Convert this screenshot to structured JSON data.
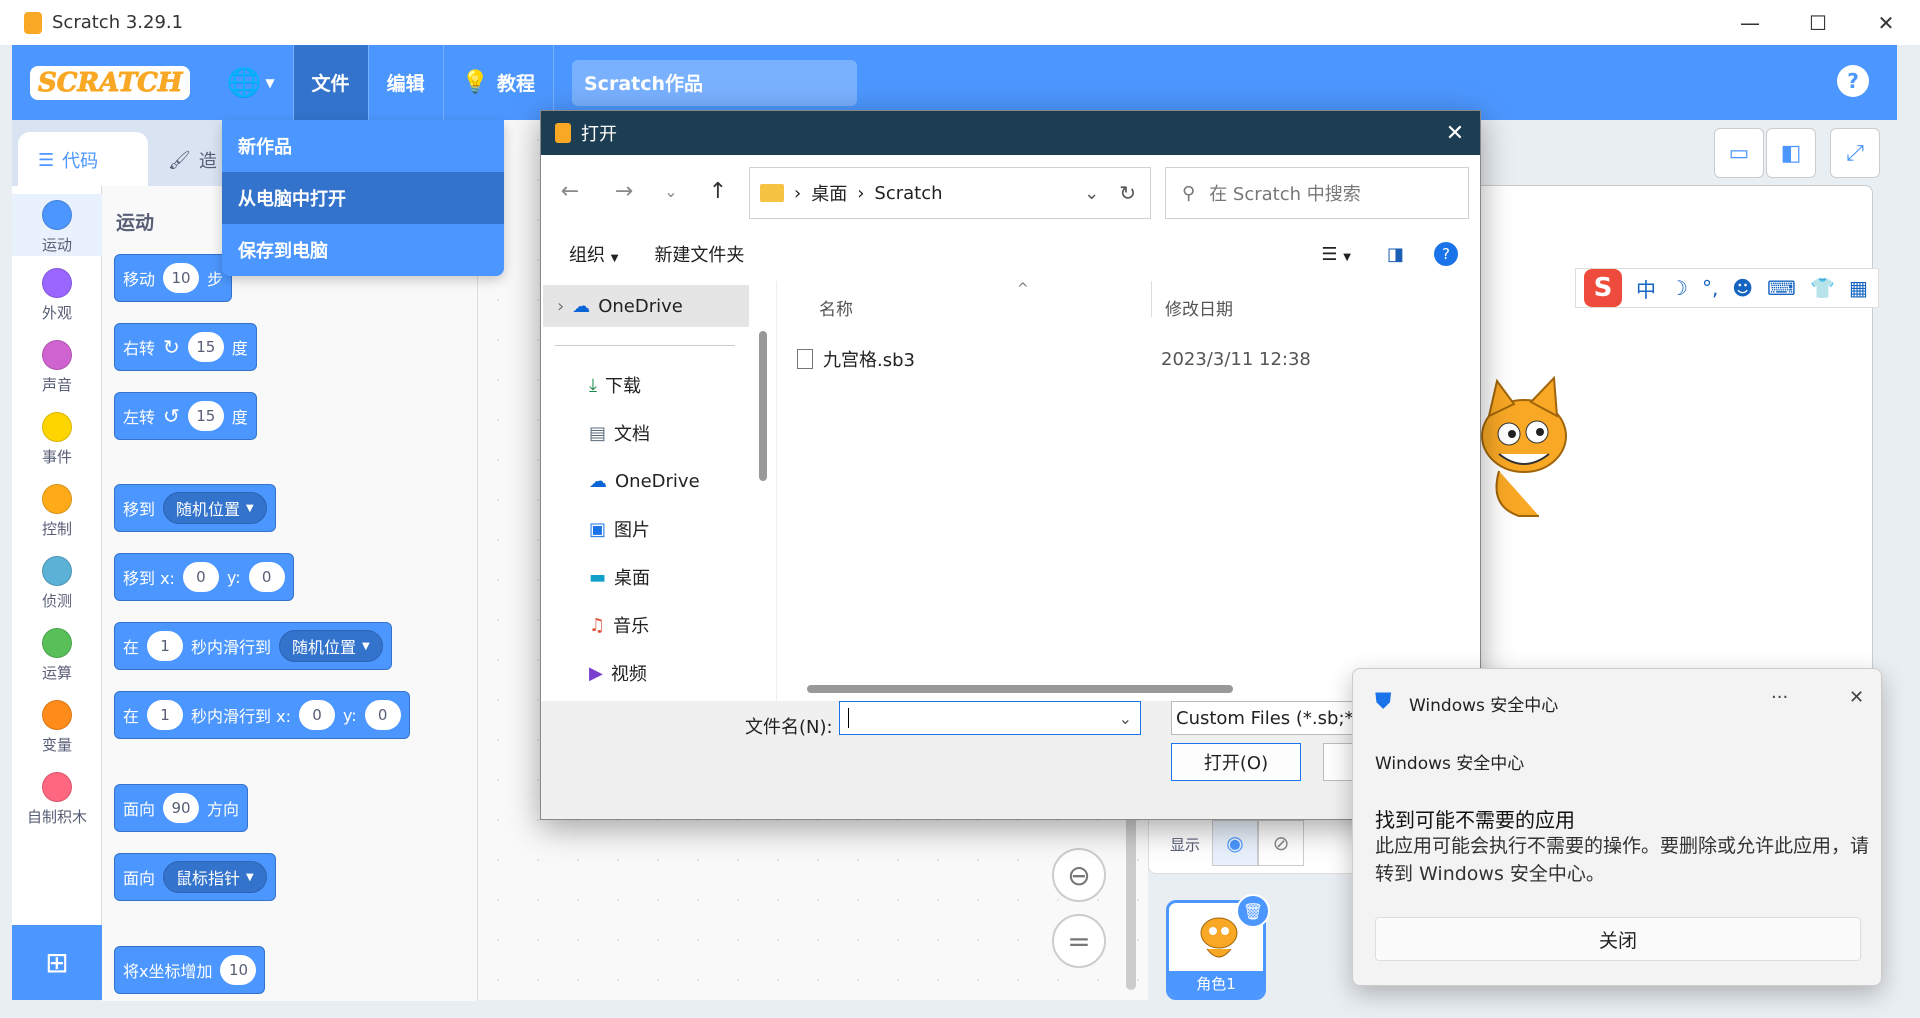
{
  "window": {
    "title": "Scratch 3.29.1"
  },
  "menubar": {
    "logo": "SCRATCH",
    "file": "文件",
    "edit": "编辑",
    "tutorials": "教程",
    "project_title": "Scratch作品",
    "help": "?"
  },
  "file_menu": {
    "items": [
      "新作品",
      "从电脑中打开",
      "保存到电脑"
    ]
  },
  "tabs": {
    "code": "代码",
    "costumes": "造"
  },
  "categories": [
    {
      "label": "运动",
      "color": "#4c97ff"
    },
    {
      "label": "外观",
      "color": "#9966ff"
    },
    {
      "label": "声音",
      "color": "#cf63cf"
    },
    {
      "label": "事件",
      "color": "#ffd500"
    },
    {
      "label": "控制",
      "color": "#ffab19"
    },
    {
      "label": "侦测",
      "color": "#5cb1d6"
    },
    {
      "label": "运算",
      "color": "#59c059"
    },
    {
      "label": "变量",
      "color": "#ff8c1a"
    },
    {
      "label": "自制积木",
      "color": "#ff6680"
    }
  ],
  "palette": {
    "title": "运动",
    "move": {
      "a": "移动",
      "n": "10",
      "b": "步"
    },
    "turn_right": {
      "a": "右转",
      "n": "15",
      "b": "度"
    },
    "turn_left": {
      "a": "左转",
      "n": "15",
      "b": "度"
    },
    "goto": {
      "a": "移到",
      "dd": "随机位置"
    },
    "goto_xy": {
      "a": "移到 x:",
      "x": "0",
      "yl": "y:",
      "y": "0"
    },
    "glide": {
      "a": "在",
      "n": "1",
      "b": "秒内滑行到",
      "dd": "随机位置"
    },
    "glide_xy": {
      "a": "在",
      "n": "1",
      "b": "秒内滑行到 x:",
      "x": "0",
      "yl": "y:",
      "y": "0"
    },
    "point_dir": {
      "a": "面向",
      "n": "90",
      "b": "方向"
    },
    "point_to": {
      "a": "面向",
      "dd": "鼠标指针"
    },
    "change_x": {
      "a": "将x坐标增加",
      "n": "10"
    }
  },
  "zoom": {
    "equal": "="
  },
  "sprite_pane": {
    "show_label": "显示",
    "sprite_name": "角色1"
  },
  "ime": {
    "logo": "S",
    "mode": "中",
    "moon": "☽",
    "punct": "°,"
  },
  "dialog": {
    "title": "打开",
    "path": [
      "桌面",
      "Scratch"
    ],
    "search_placeholder": "在 Scratch 中搜索",
    "organize": "组织",
    "new_folder": "新建文件夹",
    "sidebar": [
      {
        "label": "OneDrive"
      },
      {
        "label": "下载"
      },
      {
        "label": "文档"
      },
      {
        "label": "OneDrive"
      },
      {
        "label": "图片"
      },
      {
        "label": "桌面"
      },
      {
        "label": "音乐"
      },
      {
        "label": "视频"
      }
    ],
    "columns": {
      "name": "名称",
      "modified": "修改日期"
    },
    "files": [
      {
        "name": "九宫格.sb3",
        "modified": "2023/3/11 12:38"
      }
    ],
    "filename_label": "文件名(N):",
    "filename_value": "",
    "filetype": "Custom Files (*.sb;*.s",
    "open_button": "打开(O)"
  },
  "toast": {
    "app": "Windows 安全中心",
    "more": "···",
    "source": "Windows 安全中心",
    "heading": "找到可能不需要的应用",
    "body": "此应用可能会执行不需要的操作。要删除或允许此应用，请转到 Windows 安全中心。",
    "close_button": "关闭"
  }
}
